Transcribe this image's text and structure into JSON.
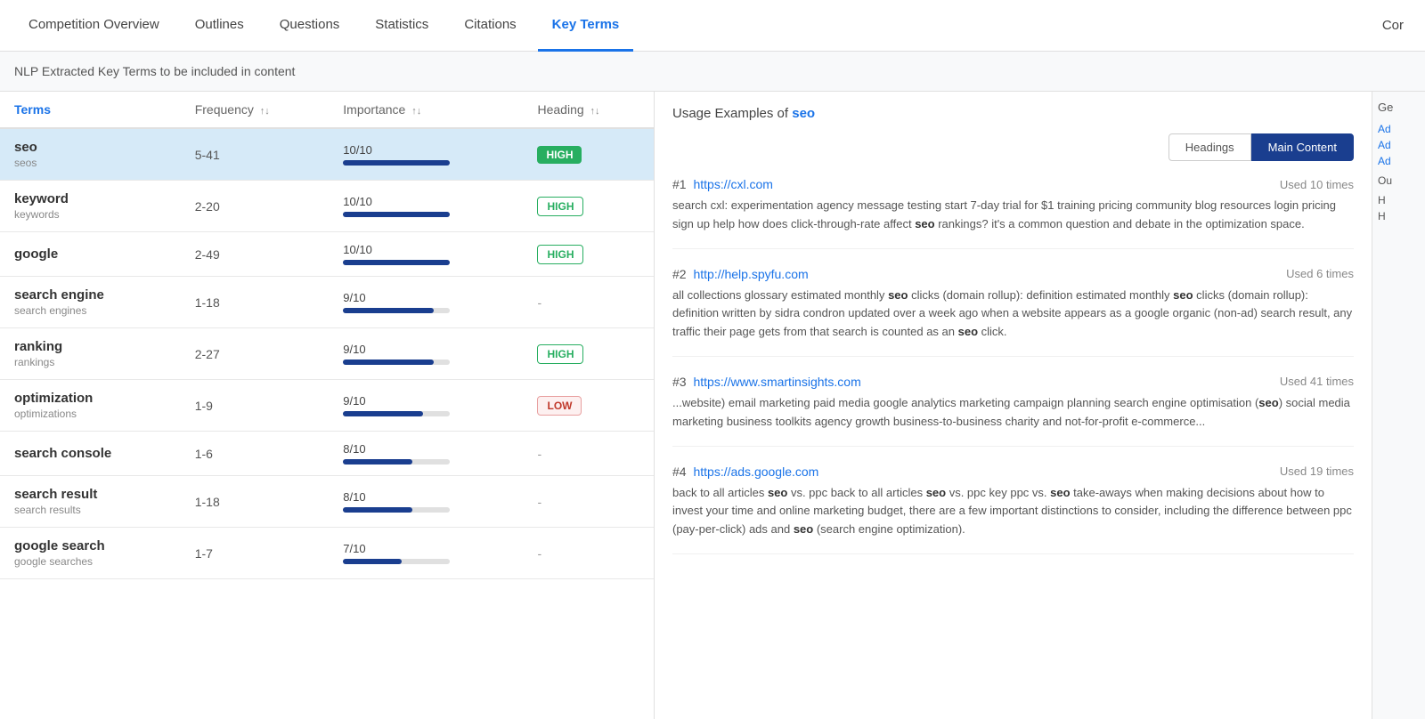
{
  "nav": {
    "items": [
      {
        "id": "competition-overview",
        "label": "Competition Overview",
        "active": false
      },
      {
        "id": "outlines",
        "label": "Outlines",
        "active": false
      },
      {
        "id": "questions",
        "label": "Questions",
        "active": false
      },
      {
        "id": "statistics",
        "label": "Statistics",
        "active": false
      },
      {
        "id": "citations",
        "label": "Citations",
        "active": false
      },
      {
        "id": "key-terms",
        "label": "Key Terms",
        "active": true
      },
      {
        "id": "cor",
        "label": "Cor",
        "active": false
      }
    ]
  },
  "subtitle": "NLP Extracted Key Terms to be included in content",
  "table": {
    "columns": {
      "terms": "Terms",
      "frequency": "Frequency",
      "importance": "Importance",
      "heading": "Heading"
    },
    "rows": [
      {
        "term": "seo",
        "alt": "seos",
        "freq": "5-41",
        "imp_label": "10/10",
        "imp_pct": 100,
        "heading_type": "high-solid",
        "heading_text": "HIGH",
        "selected": true
      },
      {
        "term": "keyword",
        "alt": "keywords",
        "freq": "2-20",
        "imp_label": "10/10",
        "imp_pct": 100,
        "heading_type": "high-outline",
        "heading_text": "HIGH",
        "selected": false
      },
      {
        "term": "google",
        "alt": "",
        "freq": "2-49",
        "imp_label": "10/10",
        "imp_pct": 100,
        "heading_type": "high-outline",
        "heading_text": "HIGH",
        "selected": false
      },
      {
        "term": "search engine",
        "alt": "search engines",
        "freq": "1-18",
        "imp_label": "9/10",
        "imp_pct": 85,
        "heading_type": "dash",
        "heading_text": "-",
        "selected": false
      },
      {
        "term": "ranking",
        "alt": "rankings",
        "freq": "2-27",
        "imp_label": "9/10",
        "imp_pct": 85,
        "heading_type": "high-outline",
        "heading_text": "HIGH",
        "selected": false
      },
      {
        "term": "optimization",
        "alt": "optimizations",
        "freq": "1-9",
        "imp_label": "9/10",
        "imp_pct": 75,
        "heading_type": "low-outline",
        "heading_text": "LOW",
        "selected": false
      },
      {
        "term": "search console",
        "alt": "",
        "freq": "1-6",
        "imp_label": "8/10",
        "imp_pct": 65,
        "heading_type": "dash",
        "heading_text": "-",
        "selected": false
      },
      {
        "term": "search result",
        "alt": "search results",
        "freq": "1-18",
        "imp_label": "8/10",
        "imp_pct": 65,
        "heading_type": "dash",
        "heading_text": "-",
        "selected": false
      },
      {
        "term": "google search",
        "alt": "google searches",
        "freq": "1-7",
        "imp_label": "7/10",
        "imp_pct": 55,
        "heading_type": "dash",
        "heading_text": "-",
        "selected": false
      }
    ]
  },
  "right_panel": {
    "usage_label": "Usage Examples of",
    "usage_term": "seo",
    "toggle": {
      "headings": "Headings",
      "main_content": "Main Content",
      "active": "main_content"
    },
    "examples": [
      {
        "num": "#1",
        "url": "https://cxl.com",
        "used": "Used 10 times",
        "text": "search cxl: experimentation agency message testing start 7-day trial for $1 training pricing community blog resources login pricing sign up help how does click-through-rate affect {seo} rankings? it's a common question and debate in the optimization space.",
        "bold_term": "seo"
      },
      {
        "num": "#2",
        "url": "http://help.spyfu.com",
        "used": "Used 6 times",
        "text": "all collections glossary estimated monthly {seo} clicks (domain rollup): definition estimated monthly {seo} clicks (domain rollup): definition written by sidra condron updated over a week ago when a website appears as a google organic (non-ad) search result, any traffic their page gets from that search is counted as an {seo} click.",
        "bold_term": "seo"
      },
      {
        "num": "#3",
        "url": "https://www.smartinsights.com",
        "used": "Used 41 times",
        "text": "...website) email marketing paid media google analytics marketing campaign planning search engine optimisation ({seo}) social media marketing business toolkits agency growth business-to-business charity and not-for-profit e-commerce...",
        "bold_term": "seo"
      },
      {
        "num": "#4",
        "url": "https://ads.google.com",
        "used": "Used 19 times",
        "text": "back to all articles {seo} vs. ppc back to all articles {seo} vs. ppc key ppc vs. {seo} take-aways when making decisions about how to invest your time and online marketing budget, there are a few important distinctions to consider, including the difference between ppc (pay-per-click) ads and {seo} (search engine optimization).",
        "bold_term": "seo"
      }
    ]
  },
  "right_peek": {
    "label": "Ge",
    "items": [
      "Ad",
      "Ad",
      "Ad",
      "Ou",
      "H",
      "H"
    ]
  }
}
